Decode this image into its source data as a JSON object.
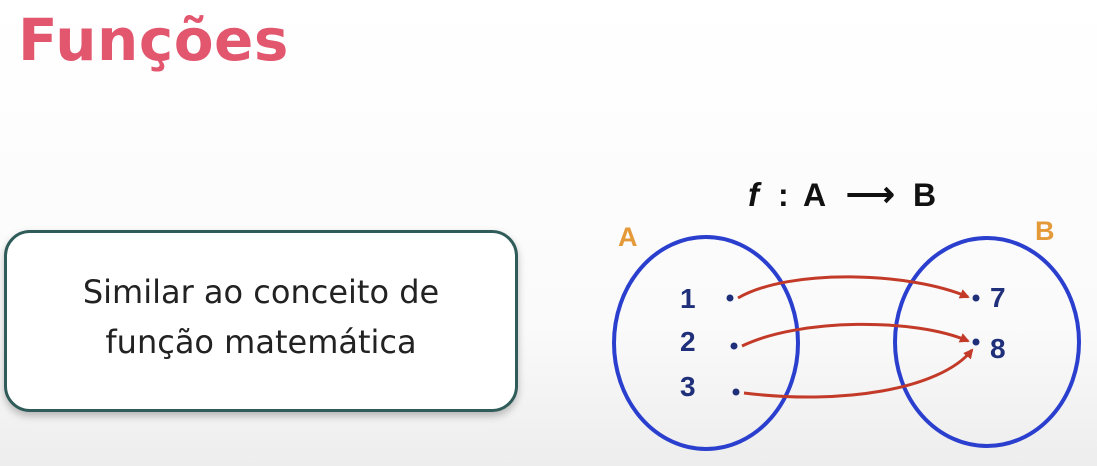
{
  "title": "Funções",
  "callout": {
    "line1": "Similar ao conceito de",
    "line2": "função matemática"
  },
  "diagram": {
    "func_name": "f",
    "func_sep": ":",
    "func_domain": "A",
    "func_arrow": "⟶",
    "func_codomain": "B",
    "set_a_label": "A",
    "set_b_label": "B",
    "domain_elements": [
      "1",
      "2",
      "3"
    ],
    "codomain_elements": [
      "7",
      "8"
    ],
    "mappings": [
      [
        "1",
        "7"
      ],
      [
        "2",
        "8"
      ],
      [
        "3",
        "8"
      ]
    ]
  },
  "colors": {
    "title": "#e2566e",
    "set_outline": "#2b3fcf",
    "set_label": "#e59a3a",
    "element_text": "#1f2f7a",
    "mapping_arrow": "#c33a28",
    "formula": "#111111",
    "callout_border": "#2f5b58"
  }
}
